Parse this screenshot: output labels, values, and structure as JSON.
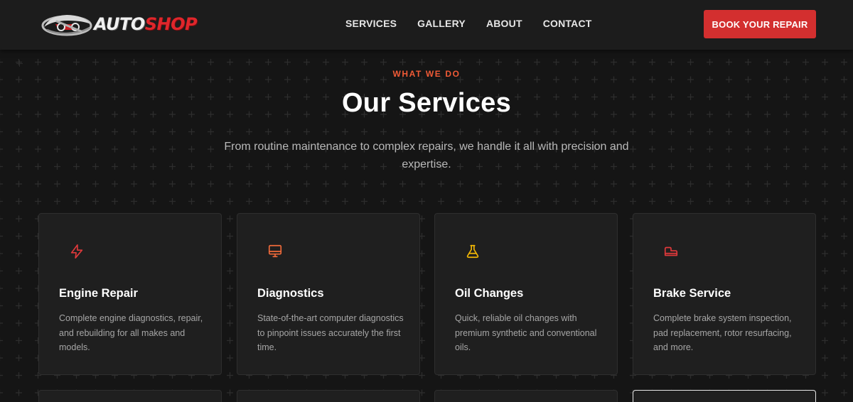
{
  "header": {
    "logo": {
      "word1": "AUTO",
      "word2": "SHOP"
    },
    "nav": [
      {
        "label": "SERVICES"
      },
      {
        "label": "GALLERY"
      },
      {
        "label": "ABOUT"
      },
      {
        "label": "CONTACT"
      }
    ],
    "cta_label": "BOOK YOUR REPAIR"
  },
  "intro": {
    "eyebrow": "WHAT WE DO",
    "title": "Our Services",
    "subtitle": "From routine maintenance to complex repairs, we handle it all with precision and expertise."
  },
  "services": [
    {
      "icon": "lightning-icon",
      "icon_color": "#e0393b",
      "title": "Engine Repair",
      "description": "Complete engine diagnostics, repair, and rebuilding for all makes and models."
    },
    {
      "icon": "monitor-icon",
      "icon_color": "#f06a3a",
      "title": "Diagnostics",
      "description": "State-of-the-art computer diagnostics to pinpoint issues accurately the first time."
    },
    {
      "icon": "flask-icon",
      "icon_color": "#f2b705",
      "title": "Oil Changes",
      "description": "Quick, reliable oil changes with premium synthetic and conventional oils."
    },
    {
      "icon": "brake-shoe-icon",
      "icon_color": "#e0393b",
      "title": "Brake Service",
      "description": "Complete brake system inspection, pad replacement, rotor resurfacing, and more."
    }
  ],
  "colors": {
    "accent": "#d32f2f",
    "eyebrow": "#f05a36",
    "background": "#151515",
    "card": "#1f1f1f"
  }
}
